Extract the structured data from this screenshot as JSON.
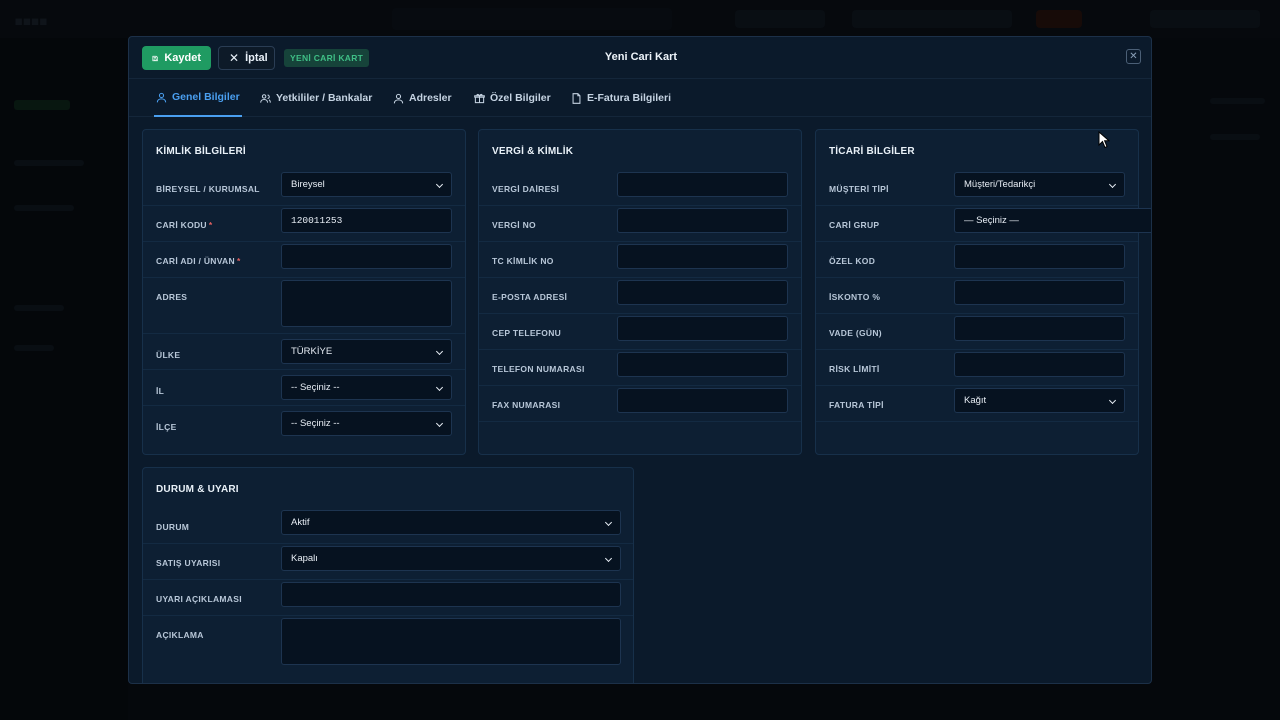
{
  "header": {
    "save_label": "Kaydet",
    "cancel_label": "İptal",
    "badge": "YENİ CARİ KART",
    "title": "Yeni Cari Kart"
  },
  "tabs": [
    {
      "label": "Genel Bilgiler",
      "icon": "user-icon",
      "active": true
    },
    {
      "label": "Yetkililer / Bankalar",
      "icon": "users-icon",
      "active": false
    },
    {
      "label": "Adresler",
      "icon": "map-pin-icon",
      "active": false
    },
    {
      "label": "Özel Bilgiler",
      "icon": "gift-icon",
      "active": false
    },
    {
      "label": "E-Fatura Bilgileri",
      "icon": "document-icon",
      "active": false
    }
  ],
  "kimlik": {
    "title": "KİMLİK BİLGİLERİ",
    "bireysel_label": "BİREYSEL / KURUMSAL",
    "bireysel_value": "Bireysel",
    "cari_kodu_label": "CARİ KODU",
    "cari_kodu_value": "120011253",
    "cari_adi_label": "CARİ ADI / ÜNVAN",
    "cari_adi_value": "",
    "adres_label": "ADRES",
    "adres_value": "",
    "ulke_label": "ÜLKE",
    "ulke_value": "TÜRKİYE",
    "il_label": "İL",
    "il_value": "-- Seçiniz --",
    "ilce_label": "İLÇE",
    "ilce_value": "-- Seçiniz --",
    "required_mark": "*"
  },
  "vergi": {
    "title": "VERGİ & KİMLİK",
    "vergi_dairesi_label": "VERGİ DAİRESİ",
    "vergi_no_label": "VERGİ NO",
    "tc_label": "TC KİMLİK NO",
    "eposta_label": "E-POSTA ADRESİ",
    "cep_label": "CEP TELEFONU",
    "telefon_label": "TELEFON NUMARASI",
    "fax_label": "FAX NUMARASI"
  },
  "ticari": {
    "title": "TİCARİ BİLGİLER",
    "musteri_tipi_label": "MÜŞTERİ TİPİ",
    "musteri_tipi_value": "Müşteri/Tedarikçi",
    "cari_grup_label": "CARİ GRUP",
    "cari_grup_value": "— Seçiniz —",
    "ozel_kod_label": "ÖZEL KOD",
    "iskonto_label": "İSKONTO %",
    "vade_label": "VADE (GÜN)",
    "risk_label": "RİSK LİMİTİ",
    "fatura_tipi_label": "FATURA TİPİ",
    "fatura_tipi_value": "Kağıt"
  },
  "durum": {
    "title": "DURUM & UYARI",
    "durum_label": "DURUM",
    "durum_value": "Aktif",
    "satis_label": "SATIŞ UYARISI",
    "satis_value": "Kapalı",
    "uyari_label": "UYARI AÇIKLAMASI",
    "aciklama_label": "AÇIKLAMA"
  },
  "colors": {
    "accent": "#4a9ff0",
    "save": "#1f9b62",
    "panel": "#0d1f33",
    "modal": "#0b1a2b"
  }
}
